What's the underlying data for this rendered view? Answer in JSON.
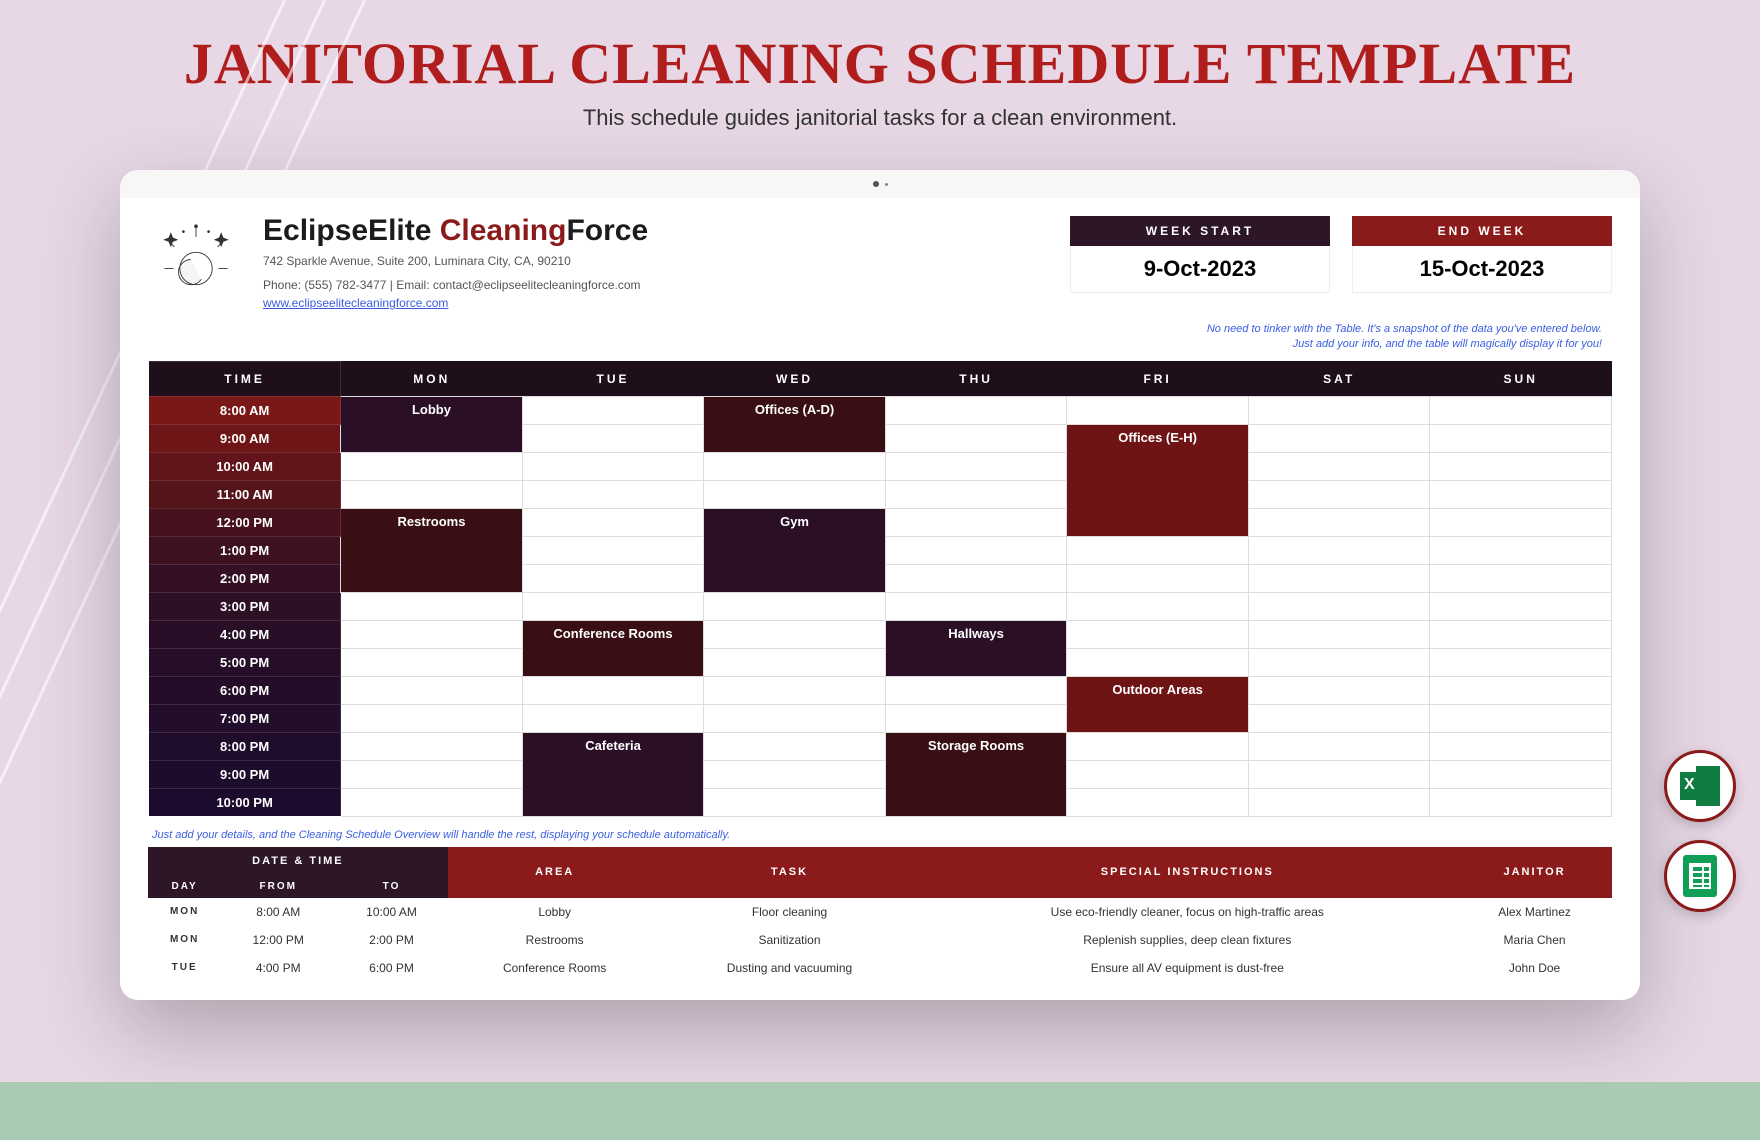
{
  "hero": {
    "title": "JANITORIAL CLEANING SCHEDULE TEMPLATE",
    "subtitle": "This schedule guides janitorial tasks for a clean environment."
  },
  "company": {
    "name_a": "EclipseElite ",
    "name_b": "Cleaning",
    "name_c": "Force",
    "addr1": "742 Sparkle Avenue, Suite 200, Luminara City, CA, 90210",
    "addr2": "Phone: (555) 782-3477 | Email: contact@eclipseelitecleaningforce.com",
    "site": "www.eclipseelitecleaningforce.com"
  },
  "week": {
    "start_label": "WEEK START",
    "start_value": "9-Oct-2023",
    "end_label": "END WEEK",
    "end_value": "15-Oct-2023"
  },
  "note_right_1": "No need to tinker with the Table. It's a snapshot of the data you've entered below.",
  "note_right_2": "Just add your info, and the table will magically display it for you!",
  "grid": {
    "headers": [
      "TIME",
      "MON",
      "TUE",
      "WED",
      "THU",
      "FRI",
      "SAT",
      "SUN"
    ],
    "times": [
      "8:00 AM",
      "9:00 AM",
      "10:00 AM",
      "11:00 AM",
      "12:00 PM",
      "1:00 PM",
      "2:00 PM",
      "3:00 PM",
      "4:00 PM",
      "5:00 PM",
      "6:00 PM",
      "7:00 PM",
      "8:00 PM",
      "9:00 PM",
      "10:00 PM"
    ],
    "time_colors": [
      "#7a1717",
      "#6e1518",
      "#611419",
      "#55131a",
      "#47121d",
      "#3d1120",
      "#351024",
      "#2d0f26",
      "#280e27",
      "#260e28",
      "#240d29",
      "#220d2a",
      "#200c2b",
      "#1e0c2c",
      "#1c0b2d"
    ],
    "blocks": [
      {
        "day": 0,
        "start": 0,
        "span": 2,
        "label": "Lobby",
        "color": "#2b0f26"
      },
      {
        "day": 0,
        "start": 4,
        "span": 3,
        "label": "Restrooms",
        "color": "#3a0f13"
      },
      {
        "day": 1,
        "start": 8,
        "span": 2,
        "label": "Conference Rooms",
        "color": "#3a0f13"
      },
      {
        "day": 1,
        "start": 12,
        "span": 3,
        "label": "Cafeteria",
        "color": "#2b0f26"
      },
      {
        "day": 2,
        "start": 0,
        "span": 2,
        "label": "Offices (A-D)",
        "color": "#3a0f13"
      },
      {
        "day": 2,
        "start": 4,
        "span": 3,
        "label": "Gym",
        "color": "#2b0f26"
      },
      {
        "day": 3,
        "start": 8,
        "span": 2,
        "label": "Hallways",
        "color": "#2b0f26"
      },
      {
        "day": 3,
        "start": 12,
        "span": 3,
        "label": "Storage Rooms",
        "color": "#3a0f13"
      },
      {
        "day": 4,
        "start": 1,
        "span": 4,
        "label": "Offices (E-H)",
        "color": "#6e1414"
      },
      {
        "day": 4,
        "start": 10,
        "span": 2,
        "label": "Outdoor Areas",
        "color": "#6e1414"
      }
    ]
  },
  "note_left": "Just add your details, and the Cleaning Schedule Overview will handle the rest, displaying your schedule automatically.",
  "detail": {
    "group_header": "DATE & TIME",
    "headers": [
      "DAY",
      "FROM",
      "TO",
      "AREA",
      "TASK",
      "SPECIAL INSTRUCTIONS",
      "JANITOR"
    ],
    "rows": [
      {
        "day": "MON",
        "from": "8:00 AM",
        "to": "10:00 AM",
        "area": "Lobby",
        "task": "Floor cleaning",
        "si": "Use eco-friendly cleaner, focus on high-traffic areas",
        "j": "Alex Martinez"
      },
      {
        "day": "MON",
        "from": "12:00 PM",
        "to": "2:00 PM",
        "area": "Restrooms",
        "task": "Sanitization",
        "si": "Replenish supplies, deep clean fixtures",
        "j": "Maria Chen"
      },
      {
        "day": "TUE",
        "from": "4:00 PM",
        "to": "6:00 PM",
        "area": "Conference Rooms",
        "task": "Dusting and vacuuming",
        "si": "Ensure all AV equipment is dust-free",
        "j": "John Doe"
      }
    ]
  },
  "badges": {
    "excel": "excel-icon",
    "sheets": "google-sheets-icon"
  }
}
